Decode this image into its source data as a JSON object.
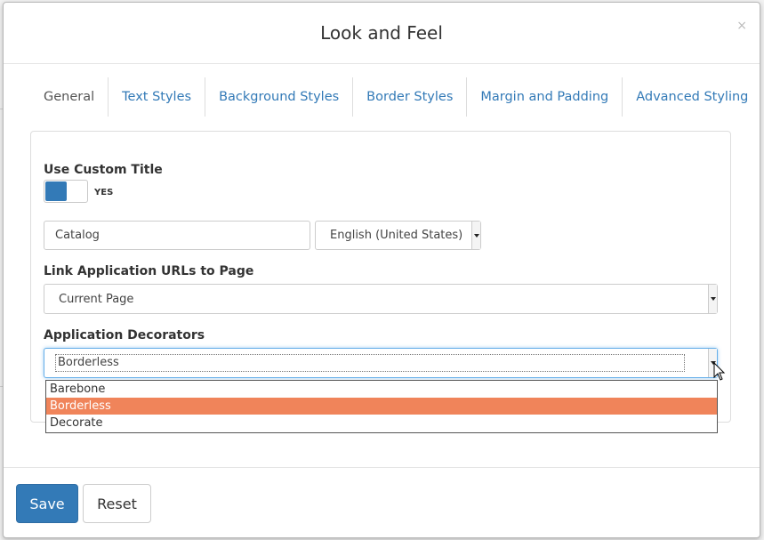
{
  "modal": {
    "title": "Look and Feel",
    "close_glyph": "×"
  },
  "tabs": [
    {
      "label": "General",
      "active": true
    },
    {
      "label": "Text Styles",
      "active": false
    },
    {
      "label": "Background Styles",
      "active": false
    },
    {
      "label": "Border Styles",
      "active": false
    },
    {
      "label": "Margin and Padding",
      "active": false
    },
    {
      "label": "Advanced Styling",
      "active": false
    }
  ],
  "general": {
    "custom_title_label": "Use Custom Title",
    "custom_title_toggle": {
      "on": true,
      "text": "YES"
    },
    "title_input_value": "Catalog",
    "language_select_value": "English (United States)",
    "link_urls_label": "Link Application URLs to Page",
    "link_urls_value": "Current Page",
    "decorators_label": "Application Decorators",
    "decorators_value": "Borderless",
    "decorators_options": [
      "Barebone",
      "Borderless",
      "Decorate"
    ],
    "decorators_selected_index": 1
  },
  "footer": {
    "save_label": "Save",
    "reset_label": "Reset"
  },
  "colors": {
    "primary": "#337ab7",
    "selected_option": "#f0845a",
    "link": "#337ab7"
  }
}
